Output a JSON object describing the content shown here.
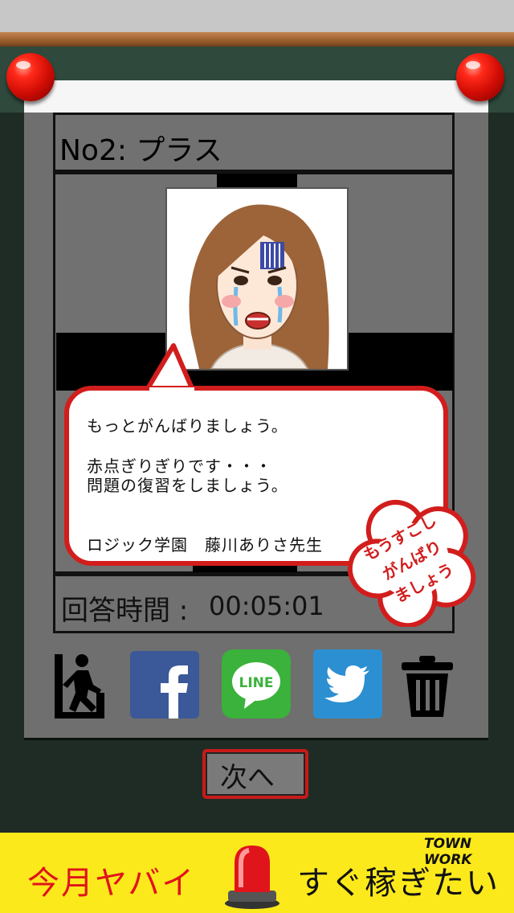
{
  "question": {
    "title": "No2: プラス"
  },
  "teacher": {
    "message_line1": "もっとがんばりましょう。",
    "message_line2": "赤点ぎりぎりです・・・",
    "message_line3": "問題の復習をしましょう。",
    "signature": "ロジック学園　藤川ありさ先生"
  },
  "stamp": {
    "line1": "もうすこし",
    "line2": "がんばり",
    "line3": "ましょう"
  },
  "answer_time": {
    "label": "回答時間 :",
    "value": "00:05:01"
  },
  "actions": {
    "line_label": "LINE"
  },
  "next_button": {
    "label": "次へ"
  },
  "ad": {
    "left_text": "今月ヤバイ",
    "right_text": "すぐ稼ぎたい",
    "brand": "TOWN WORK"
  },
  "colors": {
    "accent_red": "#d21d1d",
    "board_green": "#2f4a3d",
    "ad_yellow": "#fbe91c",
    "facebook": "#3b5998",
    "line": "#3bb23b",
    "twitter": "#2c8fd1"
  }
}
